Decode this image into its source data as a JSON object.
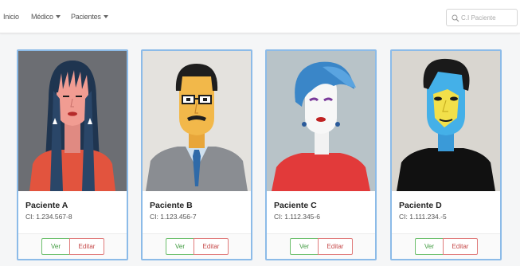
{
  "nav": {
    "items": [
      {
        "label": "Inicio",
        "dropdown": false
      },
      {
        "label": "Médico",
        "dropdown": true
      },
      {
        "label": "Pacientes",
        "dropdown": true
      }
    ],
    "search_placeholder": "C.I Paciente"
  },
  "patients": [
    {
      "name": "Paciente A",
      "ci": "CI: 1.234.567-8",
      "view_label": "Ver",
      "edit_label": "Editar"
    },
    {
      "name": "Paciente B",
      "ci": "CI: 1.123.456-7",
      "view_label": "Ver",
      "edit_label": "Editar"
    },
    {
      "name": "Paciente C",
      "ci": "CI: 1.112.345-6",
      "view_label": "Ver",
      "edit_label": "Editar"
    },
    {
      "name": "Paciente D",
      "ci": "CI: 1.111.234.-5",
      "view_label": "Ver",
      "edit_label": "Editar"
    }
  ],
  "colors": {
    "card_border": "#8cbbe8",
    "view_button": "#3f9a3f",
    "edit_button": "#c64a4a"
  },
  "icons": {
    "search": "search-icon",
    "dropdown": "caret-down-icon"
  }
}
